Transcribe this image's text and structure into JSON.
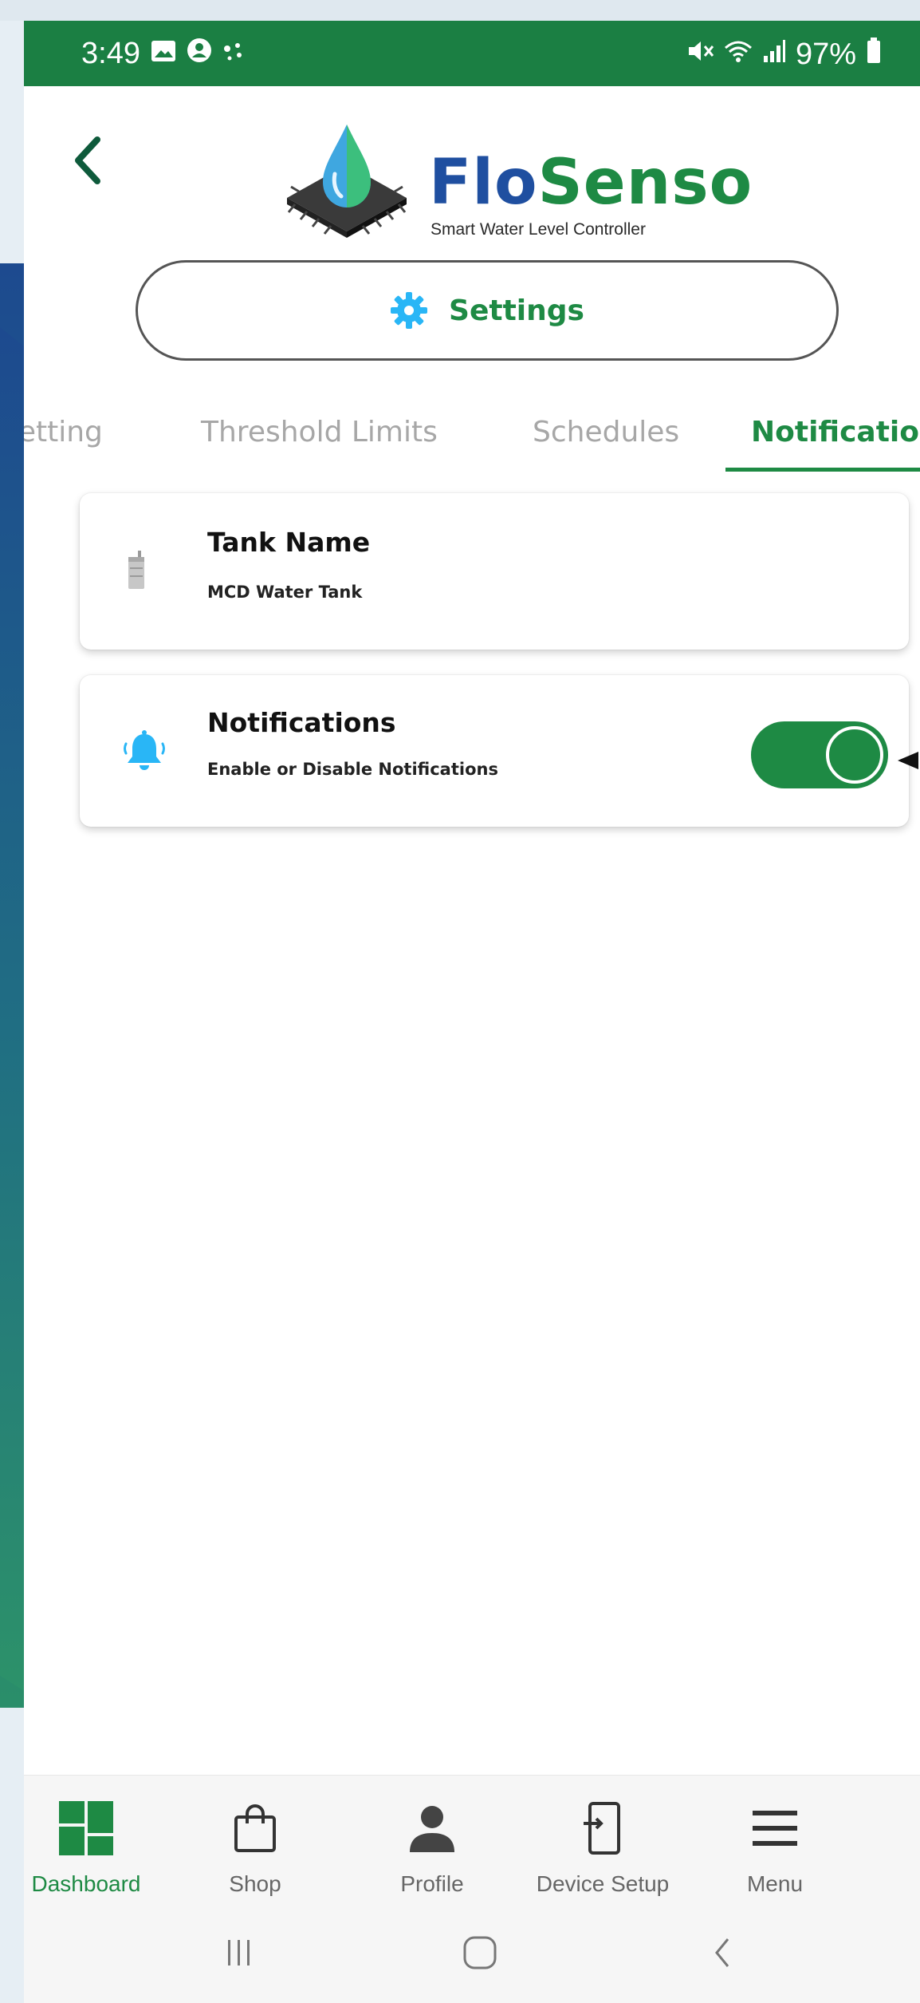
{
  "status_bar": {
    "time": "3:49",
    "battery": "97%",
    "left_icons": [
      "gallery-icon",
      "account-icon",
      "dots-icon"
    ],
    "right_icons": [
      "mute-icon",
      "wifi-icon",
      "signal-icon",
      "battery-icon"
    ]
  },
  "header": {
    "back_icon": "chevron-left-icon",
    "logo": {
      "brand_part1": "Flo",
      "brand_part2": "Senso",
      "tagline": "Smart Water Level Controller"
    }
  },
  "settings_button": {
    "label": "Settings",
    "icon": "gear-icon"
  },
  "tabs": [
    {
      "label": "Setting",
      "active": false
    },
    {
      "label": "Threshold Limits",
      "active": false
    },
    {
      "label": "Schedules",
      "active": false
    },
    {
      "label": "Notification",
      "active": true
    }
  ],
  "cards": {
    "tank": {
      "icon": "tank-icon",
      "title": "Tank Name",
      "subtitle": "MCD Water Tank"
    },
    "notifications": {
      "icon": "bell-icon",
      "title": "Notifications",
      "subtitle": "Enable or Disable Notifications",
      "enabled": true
    }
  },
  "bottom_nav": [
    {
      "label": "Dashboard",
      "icon": "dashboard-icon",
      "active": true
    },
    {
      "label": "Shop",
      "icon": "shopping-bag-icon",
      "active": false
    },
    {
      "label": "Profile",
      "icon": "person-icon",
      "active": false
    },
    {
      "label": "Device Setup",
      "icon": "device-setup-icon",
      "active": false
    },
    {
      "label": "Menu",
      "icon": "hamburger-menu-icon",
      "active": false
    }
  ],
  "system_nav": [
    "recent-apps-icon",
    "home-icon",
    "back-icon"
  ],
  "colors": {
    "primary_green": "#1e8a44",
    "status_bar": "#1b7f43",
    "brand_blue": "#1f4fa0",
    "accent_blue": "#29b6f6",
    "inactive_tab": "#a7a7a7"
  }
}
